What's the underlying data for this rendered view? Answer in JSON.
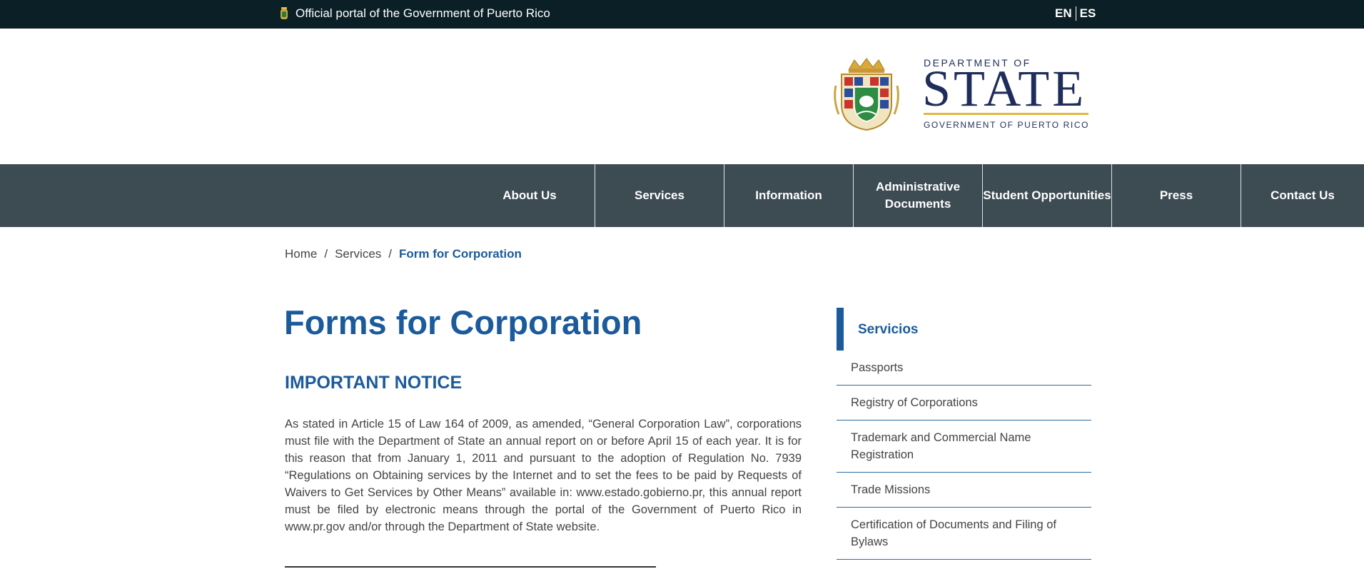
{
  "topbar": {
    "portal_text": "Official portal of the Government of Puerto Rico",
    "lang_en": "EN",
    "lang_es": "ES"
  },
  "logo": {
    "department_of": "DEPARTMENT OF",
    "state": "STATE",
    "government": "GOVERNMENT OF PUERTO RICO",
    "colors": {
      "navy": "#1f2d5a",
      "gold": "#e1b845"
    }
  },
  "nav": {
    "items": [
      {
        "label": "About Us"
      },
      {
        "label": "Services"
      },
      {
        "label": "Information"
      },
      {
        "label": "Administrative Documents"
      },
      {
        "label": "Student Opportunities"
      },
      {
        "label": "Press"
      },
      {
        "label": "Contact Us"
      }
    ]
  },
  "breadcrumb": {
    "home": "Home",
    "sep": "/",
    "services": "Services",
    "current": "Form for Corporation"
  },
  "main": {
    "title": "Forms for Corporation",
    "notice_heading": "IMPORTANT NOTICE",
    "paragraph": "As stated in Article 15 of Law 164 of 2009, as amended, “General Corporation Law”, corporations must file with the Department of State an annual report on or before April 15 of each year. It is for this reason that from January 1, 2011 and pursuant to the adoption of Regulation No. 7939 “Regulations on Obtaining services by the Internet and to set the fees to be paid by Requests of Waivers to Get Services by Other Means” available in: www.estado.gobierno.pr, this annual report must be filed by electronic means through the portal of the Government of Puerto Rico in www.pr.gov and/or through the Department of State website."
  },
  "sidebar": {
    "heading": "Servicios",
    "links": [
      "Passports",
      "Registry of Corporations",
      "Trademark and Commercial Name Registration",
      "Trade Missions",
      "Certification of Documents and Filing of Bylaws"
    ]
  },
  "colors": {
    "topbar_bg": "#0a1f26",
    "nav_bg": "#3d4b53",
    "accent_blue": "#1b5b9b"
  }
}
